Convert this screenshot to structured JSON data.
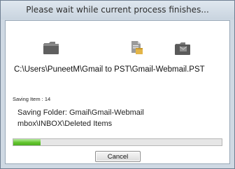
{
  "window": {
    "title": "Please wait while current process finishes..."
  },
  "icons": [
    "folder-icon",
    "document-icon",
    "mailbox-folder-icon"
  ],
  "path": "C:\\Users\\PuneetM\\Gmail to PST\\Gmail-Webmail.PST",
  "status": {
    "saving_item": "Saving Item : 14",
    "saving_folder_line1": "Saving Folder: Gmail\\Gmail-Webmail",
    "saving_folder_line2": "mbox\\INBOX\\Deleted Items"
  },
  "progress": {
    "fraction": 0.13,
    "color": "#62c42c"
  },
  "buttons": {
    "cancel": "Cancel"
  }
}
